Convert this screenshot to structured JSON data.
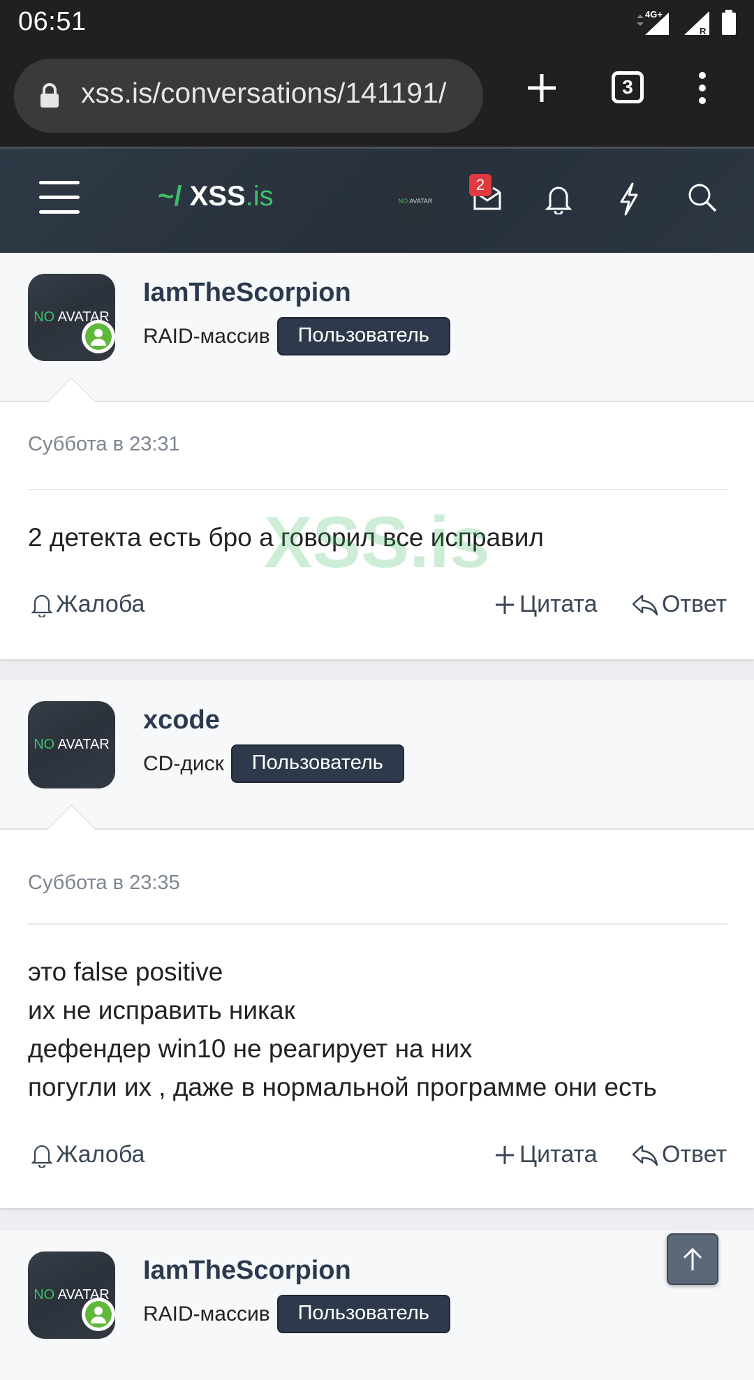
{
  "status_bar": {
    "time": "06:51",
    "network": "4G+",
    "roaming": "R"
  },
  "browser": {
    "url": "xss.is/conversations/141191/",
    "tab_count": "3"
  },
  "site_header": {
    "logo_tilde": "~/",
    "logo_main": "XSS",
    "logo_tld": ".is",
    "avatar_no": "NO",
    "avatar_text": "AVATAR",
    "inbox_badge": "2"
  },
  "watermark": "XSS.is",
  "messages": [
    {
      "username": "IamTheScorpion",
      "user_title": "RAID-массив",
      "role": "Пользователь",
      "online": true,
      "date": "Суббота в 23:31",
      "body": [
        "2 детекта есть бро а говорил все исправил"
      ]
    },
    {
      "username": "xcode",
      "user_title": "CD-диск",
      "role": "Пользователь",
      "online": false,
      "date": "Суббота в 23:35",
      "body": [
        "это false positive",
        "их не исправить никак",
        "дефендер win10 не реагирует на них",
        "погугли их , даже в нормальной программе они есть"
      ]
    },
    {
      "username": "IamTheScorpion",
      "user_title": "RAID-массив",
      "role": "Пользователь",
      "online": true
    }
  ],
  "avatar": {
    "no": "NO",
    "text": "AVATAR"
  },
  "actions": {
    "report": "Жалоба",
    "quote": "Цитата",
    "reply": "Ответ"
  },
  "colors": {
    "accent_green": "#3fbf6b",
    "header_bg": "#2c3541",
    "badge_red": "#e0393e",
    "online_green": "#5fb83a"
  }
}
